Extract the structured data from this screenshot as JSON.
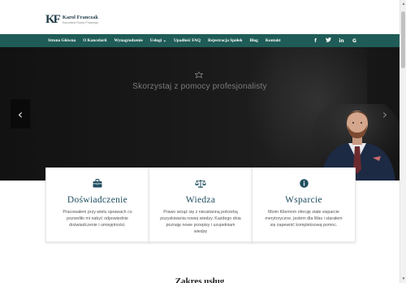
{
  "brand": {
    "mark": "KF",
    "name": "Karol Franczak",
    "subtitle": "Kancelaria Radcy Prawnego"
  },
  "nav": {
    "items": [
      "Strona Główna",
      "O Kancelarii",
      "Wynagrodzenie",
      "Usługi ⌄",
      "Upadłość FAQ",
      "Rejestracja Spółek",
      "Blog",
      "Kontakt"
    ],
    "social": [
      "f",
      "𝕏",
      "in",
      "G"
    ]
  },
  "hero": {
    "tagline": "Skorzystaj z pomocy profesjonalisty",
    "prev": "‹",
    "next": "›"
  },
  "cards": [
    {
      "title": "Doświadczenie",
      "text": "Pracowałem przy wielu sprawach co pozwoliło mi nabyć odpowiednie doświadczenie i umiejętności.",
      "icon": "briefcase-icon"
    },
    {
      "title": "Wiedza",
      "text": "Prawo wciąż się z nieustanną potrzebą pozyskiwania nowej wiedzy. Każdego dnia poznaję nowe przepisy i uzupełniam wiedzę",
      "icon": "scales-icon"
    },
    {
      "title": "Wsparcie",
      "text": "Moim Klientom oferuję stałe wsparcie merytoryczne, jestem dla Was i starałem się zapewnić kompleksową pomoc.",
      "icon": "info-icon"
    }
  ],
  "section": {
    "title": "Zakres usług"
  },
  "colors": {
    "accent": "#1f5c57",
    "title": "#1f4e5f"
  }
}
